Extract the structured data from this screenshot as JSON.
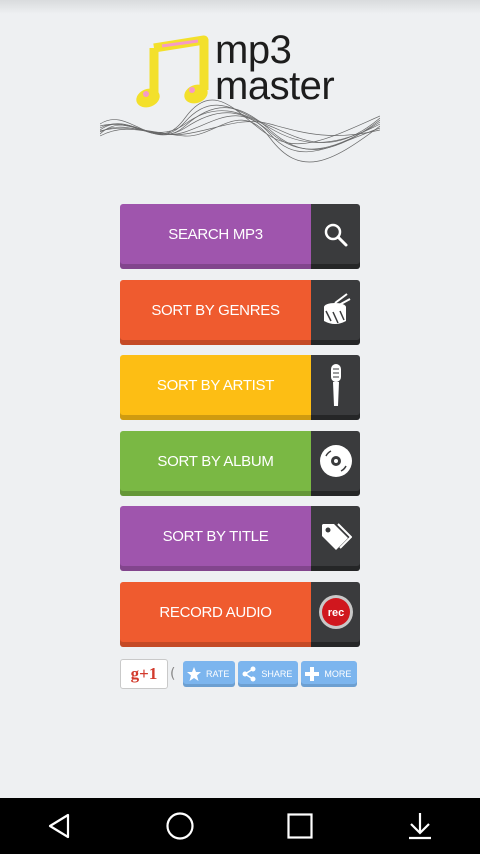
{
  "app": {
    "logo_line1": "mp3",
    "logo_line2": "master"
  },
  "menu": [
    {
      "label": "SEARCH MP3",
      "color": "#9f55ad",
      "icon": "search-icon"
    },
    {
      "label": "SORT BY GENRES",
      "color": "#ef5b2f",
      "icon": "drum-icon"
    },
    {
      "label": "SORT BY ARTIST",
      "color": "#fdbe14",
      "icon": "microphone-icon"
    },
    {
      "label": "SORT BY ALBUM",
      "color": "#7ab844",
      "icon": "disc-icon"
    },
    {
      "label": "SORT BY TITLE",
      "color": "#9f55ad",
      "icon": "tag-icon"
    },
    {
      "label": "RECORD AUDIO",
      "color": "#ef5b2f",
      "icon": "rec-icon"
    }
  ],
  "social": {
    "gplus_label": "g+1",
    "gplus_count": "(",
    "rate_label": "RATE",
    "share_label": "SHARE",
    "more_label": "MORE",
    "rec_badge": "rec"
  },
  "navbar": {
    "items": [
      "back-icon",
      "home-icon",
      "recents-icon",
      "download-icon"
    ]
  }
}
